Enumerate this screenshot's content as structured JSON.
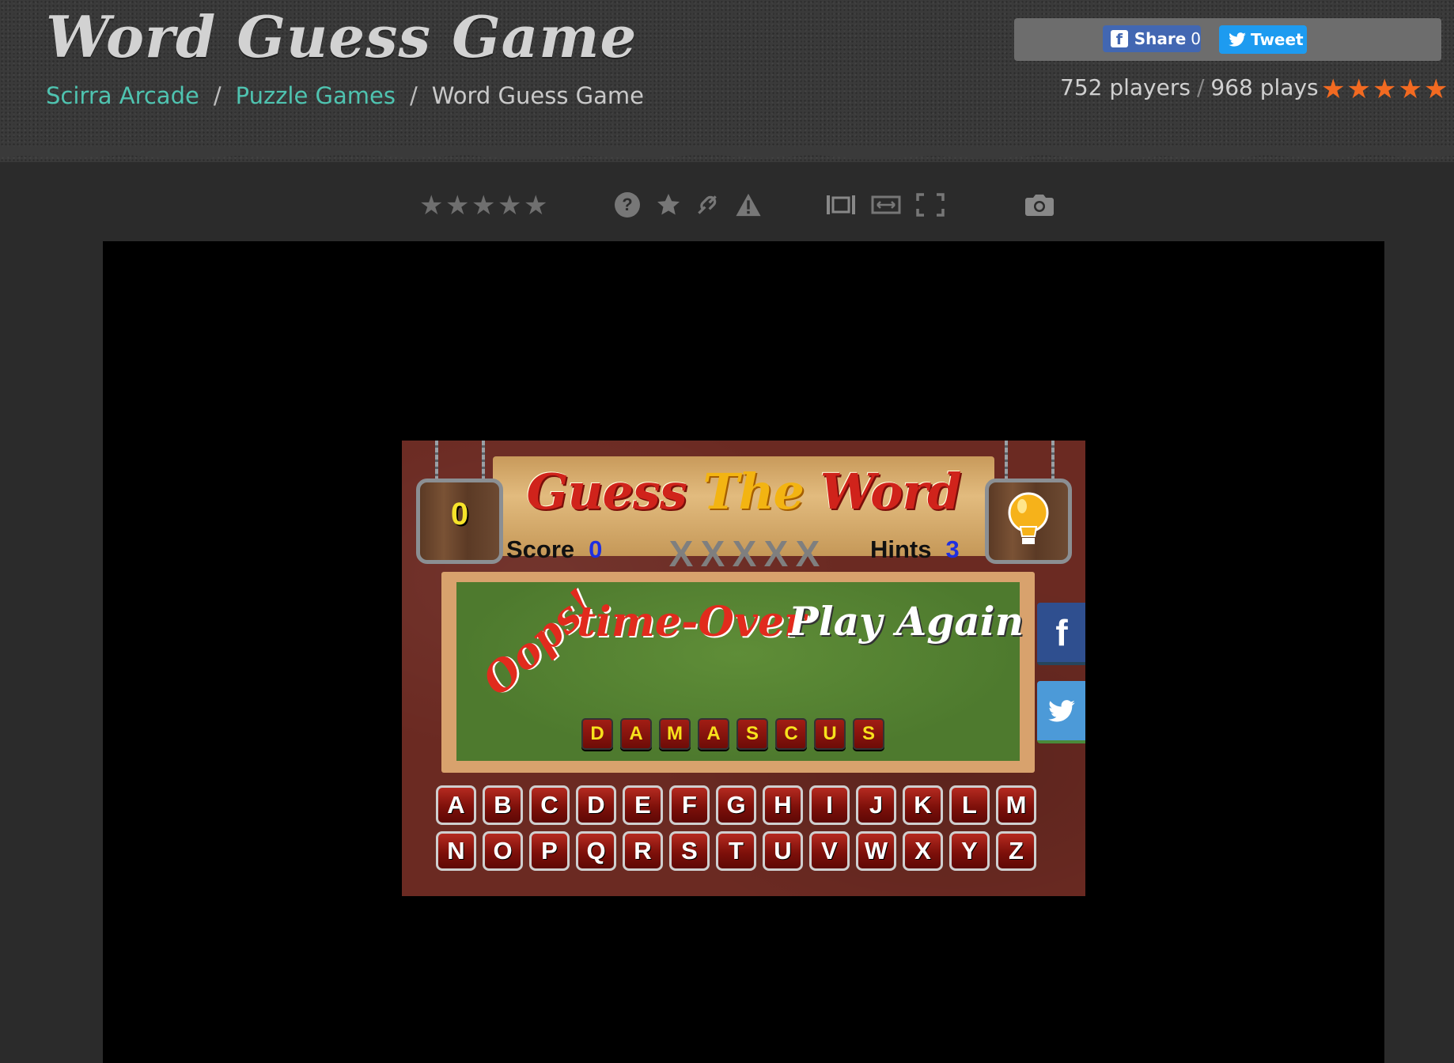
{
  "header": {
    "title": "Word Guess Game",
    "breadcrumb": [
      "Scirra Arcade",
      "Puzzle Games",
      "Word Guess Game"
    ],
    "share": {
      "facebook_label": "Share",
      "facebook_count": "0",
      "tweet_label": "Tweet"
    },
    "stats": {
      "players": "752 players",
      "separator": "/",
      "plays": "968 plays"
    },
    "rating": {
      "stars": 5,
      "max": 5
    }
  },
  "toolbar": {
    "user_rating_stars": 5,
    "icons": [
      "help-icon",
      "favorite-star-icon",
      "link-icon",
      "report-icon",
      "frame-fit-icon",
      "widescreen-icon",
      "fullscreen-icon",
      "screenshot-icon"
    ]
  },
  "game": {
    "title_left": "Guess",
    "title_mid": "The",
    "title_right": "Word",
    "sign_score": "0",
    "score_label": "Score",
    "score_value": "0",
    "hints_label": "Hints",
    "hints_value": "3",
    "strikes": [
      "X",
      "X",
      "X",
      "X",
      "X"
    ],
    "oops": "Oops!",
    "time_over": "time-Over",
    "play_again": "Play Again",
    "answer": [
      "D",
      "A",
      "M",
      "A",
      "S",
      "C",
      "U",
      "S"
    ],
    "keyboard_row1": [
      "A",
      "B",
      "C",
      "D",
      "E",
      "F",
      "G",
      "H",
      "I",
      "J",
      "K",
      "L",
      "M"
    ],
    "keyboard_row2": [
      "N",
      "O",
      "P",
      "Q",
      "R",
      "S",
      "T",
      "U",
      "V",
      "W",
      "X",
      "Y",
      "Z"
    ],
    "side_buttons": [
      "facebook-icon",
      "twitter-icon"
    ]
  },
  "colors": {
    "accent_link": "#4fc3b0",
    "rating_star": "#f26a21",
    "facebook": "#4267b2",
    "twitter": "#1d9bf0",
    "board_green": "#4e7a2e",
    "key_red": "#8e1510",
    "tile_letter": "#f7e11c"
  }
}
